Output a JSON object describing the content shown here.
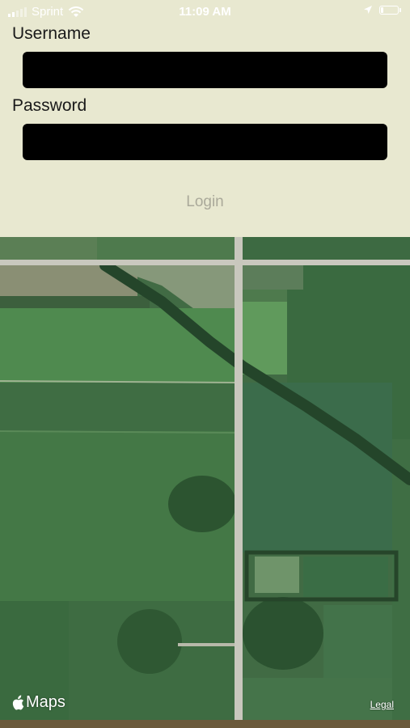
{
  "status_bar": {
    "carrier": "Sprint",
    "time": "11:09 AM"
  },
  "login_form": {
    "username_label": "Username",
    "username_value": "",
    "password_label": "Password",
    "password_value": "",
    "login_label": "Login"
  },
  "map": {
    "attribution": "Maps",
    "legal_label": "Legal"
  }
}
